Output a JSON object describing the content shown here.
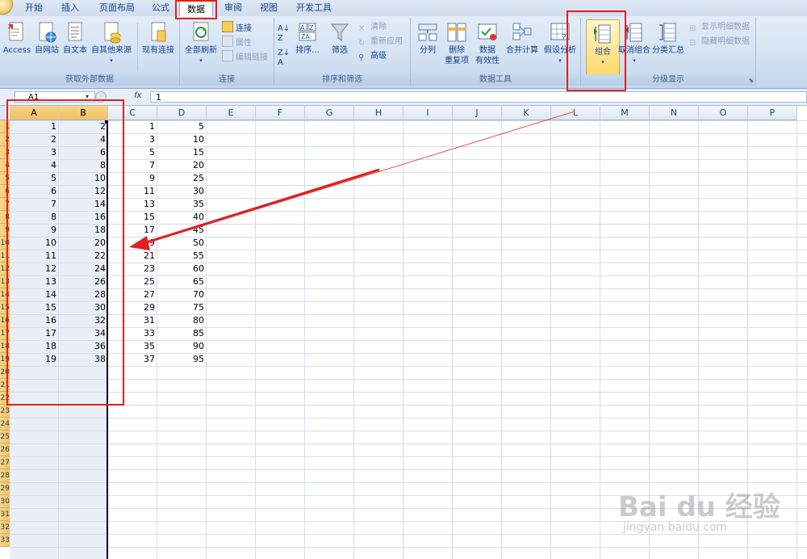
{
  "tabs": [
    "开始",
    "插入",
    "页面布局",
    "公式",
    "数据",
    "审阅",
    "视图",
    "开发工具"
  ],
  "ribbon": {
    "external": {
      "title": "获取外部数据",
      "access": "Access",
      "web": "自网站",
      "text": "自文本",
      "other": "自其他来源",
      "existing": "现有连接"
    },
    "connections": {
      "title": "连接",
      "refresh": "全部刷新",
      "conn": "连接",
      "props": "属性",
      "edit_links": "编辑链接"
    },
    "sort": {
      "title": "排序和筛选",
      "sort": "排序...",
      "filter": "筛选",
      "clear": "清除",
      "reapply": "重新应用",
      "advanced": "高级"
    },
    "tools": {
      "title": "数据工具",
      "split": "分列",
      "dedup1": "删除",
      "dedup2": "重复项",
      "valid1": "数据",
      "valid2": "有效性",
      "consolidate": "合并计算",
      "whatif": "假设分析"
    },
    "outline": {
      "title": "分级显示",
      "group": "组合",
      "ungroup": "取消组合",
      "subtotal": "分类汇总",
      "show_detail": "显示明细数据",
      "hide_detail": "隐藏明细数据"
    }
  },
  "formula_bar": {
    "name_box": "A1",
    "fx": "fx",
    "value": "1"
  },
  "columns": [
    "A",
    "B",
    "C",
    "D",
    "E",
    "F",
    "G",
    "H",
    "I",
    "J",
    "K",
    "L",
    "M",
    "N",
    "O",
    "P"
  ],
  "rows": [
    "1",
    "2",
    "3",
    "4",
    "5",
    "6",
    "7",
    "8",
    "9",
    "10",
    "11",
    "12",
    "13",
    "14",
    "15",
    "16",
    "17",
    "18",
    "19",
    "20",
    "21",
    "22",
    "23",
    "24",
    "25",
    "26",
    "27",
    "28",
    "29",
    "30",
    "31",
    "32",
    "33"
  ],
  "cells": {
    "A": [
      1,
      2,
      3,
      4,
      5,
      6,
      7,
      8,
      9,
      10,
      11,
      12,
      13,
      14,
      15,
      16,
      17,
      18,
      19
    ],
    "B": [
      2,
      4,
      6,
      8,
      10,
      12,
      14,
      16,
      18,
      20,
      22,
      24,
      26,
      28,
      30,
      32,
      34,
      36,
      38
    ],
    "C": [
      1,
      3,
      5,
      7,
      9,
      11,
      13,
      15,
      17,
      19,
      21,
      23,
      25,
      27,
      29,
      31,
      33,
      35,
      37
    ],
    "D": [
      5,
      10,
      15,
      20,
      25,
      30,
      35,
      40,
      45,
      50,
      55,
      60,
      65,
      70,
      75,
      80,
      85,
      90,
      95
    ]
  },
  "watermark": {
    "brand": "Bai du 经验",
    "url": "jingyan.baidu.com"
  },
  "colors": {
    "highlight": "#e02020",
    "ribbon": "#dbe7f5",
    "selection": "#eaeef7"
  }
}
